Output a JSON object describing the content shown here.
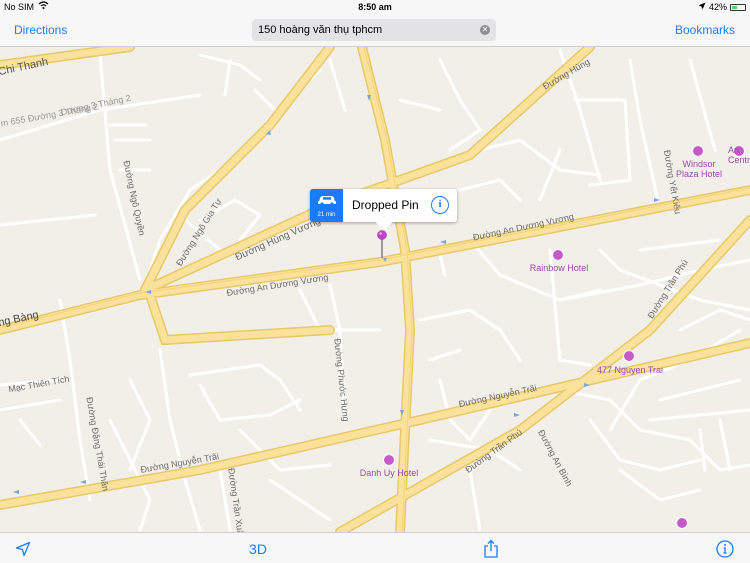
{
  "status_bar": {
    "carrier": "No SIM",
    "time": "8:50 am",
    "battery": "42%",
    "battery_level": 0.42
  },
  "nav": {
    "directions_label": "Directions",
    "bookmarks_label": "Bookmarks"
  },
  "search": {
    "value": "150 hoàng văn thụ tphcm",
    "clear_icon": "clear-circle-icon"
  },
  "callout": {
    "title": "Dropped Pin",
    "drive_time": "21 min",
    "icon": "car-icon"
  },
  "streets": [
    "Chi Thanh",
    "Dương 3 Tháng 2",
    "m 655 Đường 3 Tháng 2",
    "Đường Ngô Gia Tự",
    "Đường Ngô Quyền",
    "Đường Hùng Vương",
    "Đường An Dương Vương",
    "Đường An Dương Vương",
    "ng Bàng",
    "Đường Hùng",
    "Đường Yết Kiêu",
    "Đường Trần Phú",
    "Mạc Thiên Tích",
    "Đường Đặng Thái Thân",
    "Đường Phước Hưng",
    "Đường Nguyễn Trãi",
    "Đường Nguyễn Trãi",
    "Đường Trần Phú",
    "Đường An Bình",
    "Đường Trần Xuân"
  ],
  "pois": [
    {
      "name": "Windsor Plaza Hotel"
    },
    {
      "name": "An Centr"
    },
    {
      "name": "Rainbow Hotel"
    },
    {
      "name": "477 Nguyen Trai"
    },
    {
      "name": "Danh Uy Hotel"
    }
  ],
  "toolbar": {
    "location_icon": "location-arrow-icon",
    "three_d_label": "3D",
    "share_icon": "share-icon",
    "info_icon": "info-icon"
  },
  "colors": {
    "accent": "#1a7cf5",
    "land": "#f2efe9",
    "major_road": "#fbe29a",
    "minor_road": "#ffffff",
    "poi": "#c55bc9"
  }
}
